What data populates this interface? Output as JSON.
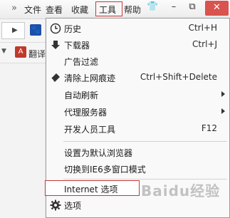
{
  "menubar": {
    "items": [
      "文件",
      "查看",
      "收藏",
      "工具",
      "帮助"
    ]
  },
  "toolbar3": {
    "translate_label": "翻译"
  },
  "tools_menu": {
    "items": [
      {
        "label": "历史",
        "shortcut": "Ctrl+H",
        "icon": "clock-icon"
      },
      {
        "label": "下载器",
        "shortcut": "Ctrl+J",
        "icon": "download-arrow-icon"
      },
      {
        "label": "广告过滤",
        "shortcut": "",
        "icon": ""
      },
      {
        "label": "清除上网痕迹",
        "shortcut": "Ctrl+Shift+Delete",
        "icon": "eraser-icon"
      },
      {
        "label": "自动刷新",
        "shortcut": "",
        "icon": "",
        "submenu": true
      },
      {
        "label": "代理服务器",
        "shortcut": "",
        "icon": "",
        "submenu": true
      },
      {
        "label": "开发人员工具",
        "shortcut": "F12",
        "icon": ""
      },
      {
        "label": "设置为默认浏览器",
        "shortcut": "",
        "icon": ""
      },
      {
        "label": "切换到IE6多窗口模式",
        "shortcut": "",
        "icon": ""
      },
      {
        "label": "Internet 选项",
        "shortcut": "",
        "icon": ""
      },
      {
        "label": "选项",
        "shortcut": "",
        "icon": "gear-icon"
      }
    ]
  },
  "colors": {
    "highlight_border": "#c63a3a",
    "close_button": "#d9534f"
  },
  "watermark": "Baidu经验"
}
